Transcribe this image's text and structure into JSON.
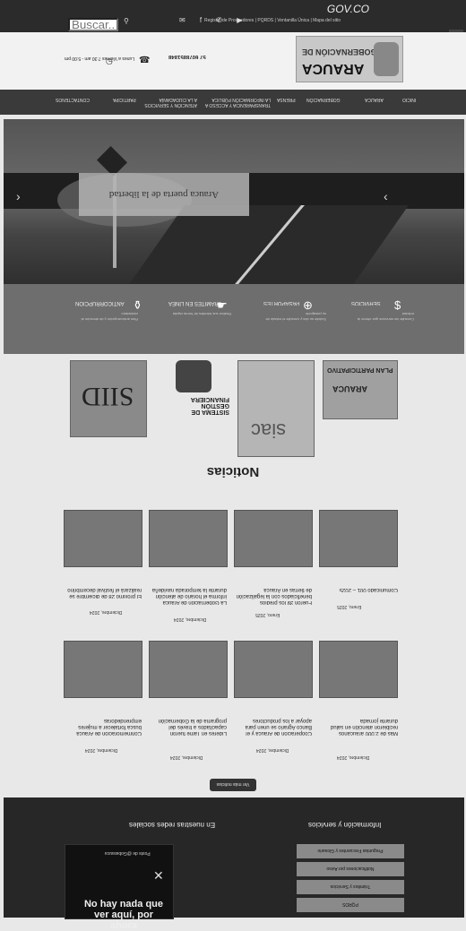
{
  "topbar": {
    "gov_label": "GOV.CO",
    "links_text": "Registro de Proveedores | PQRDS | Ventanilla Única | Mapa del sitio",
    "search_placeholder": "Buscar..."
  },
  "header": {
    "logo_line1": "GOBERNACIÓN DE",
    "logo_line2": "ARAUCA",
    "phone": "57 6078851848",
    "phone_sub": "Contáctenos",
    "contact_lines": "Lunes a Viernes 7:30 am - 5:00 pm"
  },
  "nav": [
    {
      "label": "INICIO"
    },
    {
      "label": "ARAUCA"
    },
    {
      "label": "GOBERNACIÓN"
    },
    {
      "label": "PRENSA"
    },
    {
      "label": "TRANSPARENCIA Y ACCESO A LA INFORMACIÓN PÚBLICA"
    },
    {
      "label": "ATENCIÓN Y SERVICIOS A LA CIUDADANÍA"
    },
    {
      "label": "PARTICIPA"
    },
    {
      "label": "CONTACTENOS"
    }
  ],
  "hero": {
    "caption": "Arauca puerta de la libertad"
  },
  "services": [
    {
      "title": "SERVICIOS",
      "desc": "Consulte los servicios que ofrece la entidad"
    },
    {
      "title": "PASAPORTES",
      "desc": "Solicite su cita y consulte el estado de su pasaporte"
    },
    {
      "title": "TRÁMITES EN LÍNEA",
      "desc": "Realice sus trámites de forma rápida"
    },
    {
      "title": "ANTICORRUPCIÓN",
      "desc": "Plan anticorrupción y de atención al ciudadano"
    }
  ],
  "partners": {
    "siid": "SIID",
    "sgf": "SISTEMA DE GESTIÓN FINANCIERA",
    "siac": "siac",
    "plan_title": "PLAN PARTICIPATIVO",
    "plan_sub": "ARAUCA"
  },
  "news": {
    "title": "Noticias",
    "items": [
      {
        "title": "Comunicado 001 – 2025",
        "date": "Enero, 2025"
      },
      {
        "title": "Fueron 39 los predios beneficiados con la legalización de tierras en Arauca",
        "date": "Enero, 2025"
      },
      {
        "title": "La Gobernación de Arauca informa el horario de atención durante la temporada navideña",
        "date": "Diciembre, 2024"
      },
      {
        "title": "El próximo 28 de diciembre se realizará el festival decembrino",
        "date": "Diciembre, 2024"
      },
      {
        "title": "Más de 2.000 araucanos recibieron atención en salud durante jornada",
        "date": "Diciembre, 2024"
      },
      {
        "title": "Cooperación de Arauca y el Banco Agrario se unen para apoyar a los productores",
        "date": "Diciembre, 2024"
      },
      {
        "title": "Líderes en Tame fueron capacitados a través del programa de la Gobernación",
        "date": "Diciembre, 2024"
      },
      {
        "title": "Conmemoración de Arauca busca fortalecer a mujeres emprendedoras",
        "date": "Diciembre, 2024"
      }
    ],
    "more_label": "Ver más noticias"
  },
  "footer": {
    "info_title": "Información y servicios",
    "social_title": "En nuestras redes sociales",
    "buttons": [
      "Preguntas Frecuentes y Glosario",
      "Notificaciones por Aviso",
      "Trámites y Servicios",
      "PQRDS"
    ],
    "fb_title": "Posts de @Gobarauca",
    "fb_msg": "No hay nada que ver aquí, por ahora"
  },
  "colors": {
    "topbar": "#2b2b2b",
    "nav": "#3a3a3a",
    "services": "#6e6e6e",
    "footer": "#272727"
  }
}
